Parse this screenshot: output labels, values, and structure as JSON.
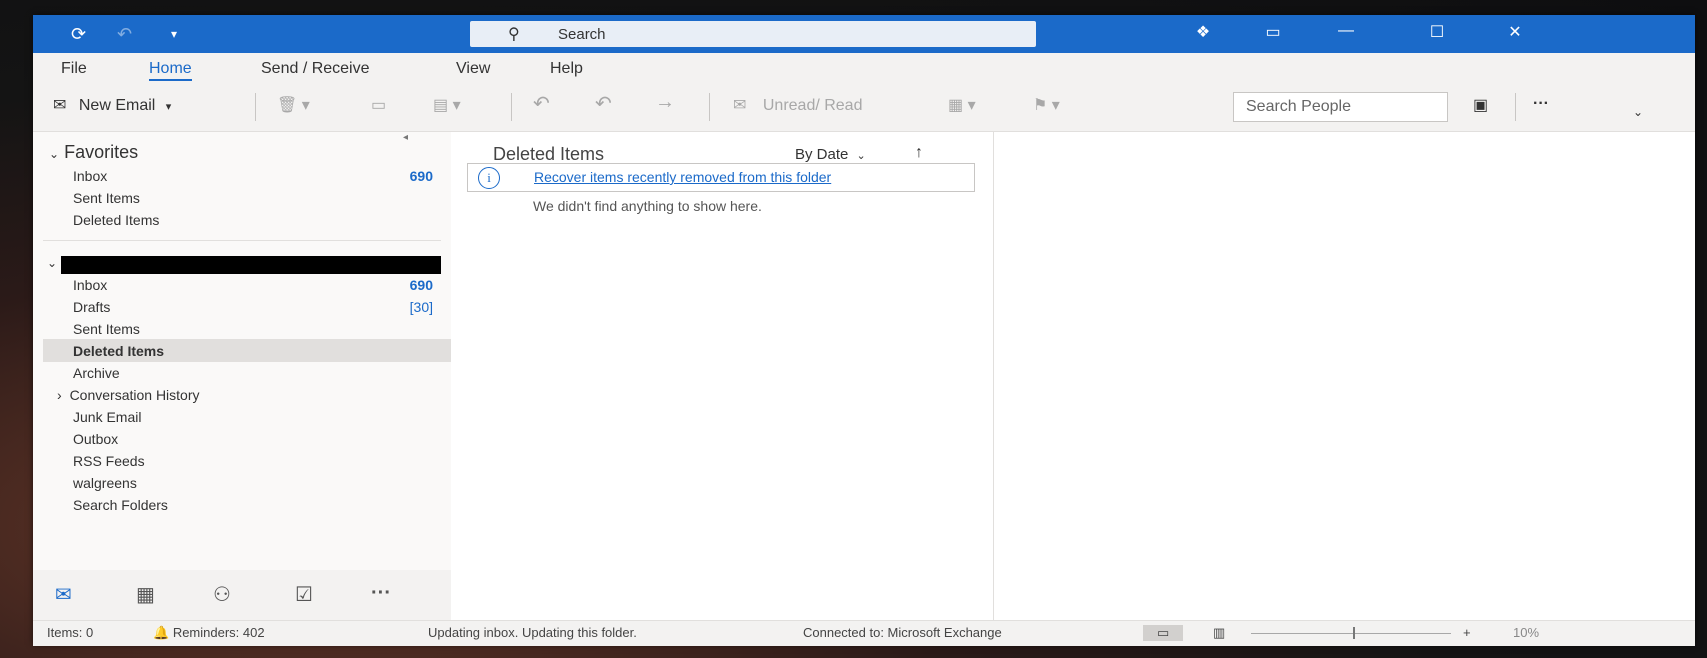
{
  "titlebar": {
    "search_placeholder": "Search",
    "icons": [
      "sync-icon",
      "undo-icon",
      "customize-icon",
      "copilot-icon",
      "reader-icon",
      "minimize-icon",
      "maximize-icon",
      "close-icon"
    ]
  },
  "tabs": [
    {
      "label": "File"
    },
    {
      "label": "Home",
      "active": true
    },
    {
      "label": "Send / Receive"
    },
    {
      "label": "View"
    },
    {
      "label": "Help"
    }
  ],
  "toolbar": {
    "new_email": "New Email",
    "unread_read": "Unread/ Read",
    "search_people": "Search People",
    "more": "···"
  },
  "folders": {
    "favorites_title": "Favorites",
    "favorites": [
      {
        "label": "Inbox",
        "count": "690"
      },
      {
        "label": "Sent Items",
        "count": ""
      },
      {
        "label": "Deleted Items",
        "count": ""
      }
    ],
    "account": [
      {
        "label": "Inbox",
        "count": "690"
      },
      {
        "label": "Drafts",
        "count": "[30]"
      },
      {
        "label": "Sent Items",
        "count": ""
      },
      {
        "label": "Deleted Items",
        "count": "",
        "selected": true
      },
      {
        "label": "Archive",
        "count": ""
      },
      {
        "label": "Conversation History",
        "count": "",
        "expandable": true
      },
      {
        "label": "Junk Email",
        "count": ""
      },
      {
        "label": "Outbox",
        "count": ""
      },
      {
        "label": "RSS Feeds",
        "count": ""
      },
      {
        "label": "walgreens",
        "count": ""
      },
      {
        "label": "Search Folders",
        "count": ""
      }
    ]
  },
  "navbar": {
    "more": "···"
  },
  "message_list": {
    "title": "Deleted Items",
    "sort": "By Date",
    "recover_link": "Recover items recently removed from this folder",
    "empty_text": "We didn't find anything to show here."
  },
  "status": {
    "items": "Items: 0",
    "reminders": "Reminders: 402",
    "updating": "Updating inbox.  Updating this folder.",
    "connection": "Connected to: Microsoft Exchange",
    "zoom": "10%"
  },
  "colors": {
    "accent": "#1b6ac9",
    "selected": "#e1dfdd"
  }
}
